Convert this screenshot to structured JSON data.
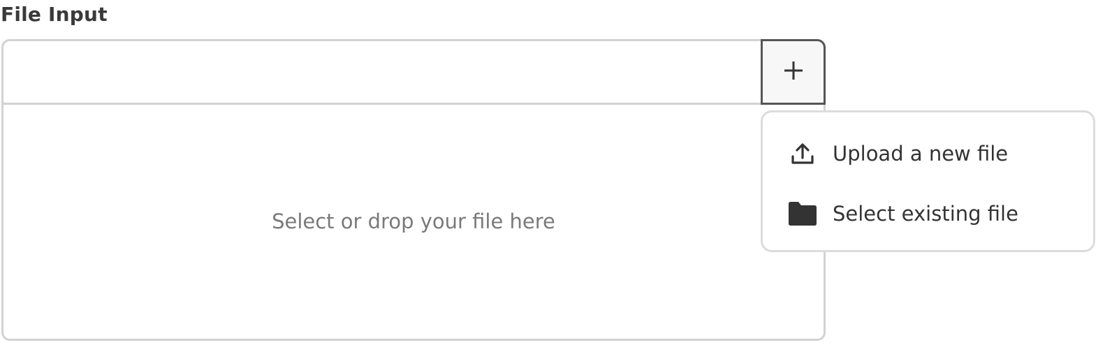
{
  "form": {
    "label": "File Input"
  },
  "file_input": {
    "value": "",
    "add_button_icon": "plus-icon",
    "drop_zone_text": "Select or drop your file here"
  },
  "menu": {
    "items": [
      {
        "label": "Upload a new file",
        "icon": "upload-icon"
      },
      {
        "label": "Select existing file",
        "icon": "folder-icon"
      }
    ]
  },
  "colors": {
    "border": "#d2d2d2",
    "button_border": "#555555",
    "icon": "#333333",
    "placeholder_text": "#7a7a7a"
  }
}
